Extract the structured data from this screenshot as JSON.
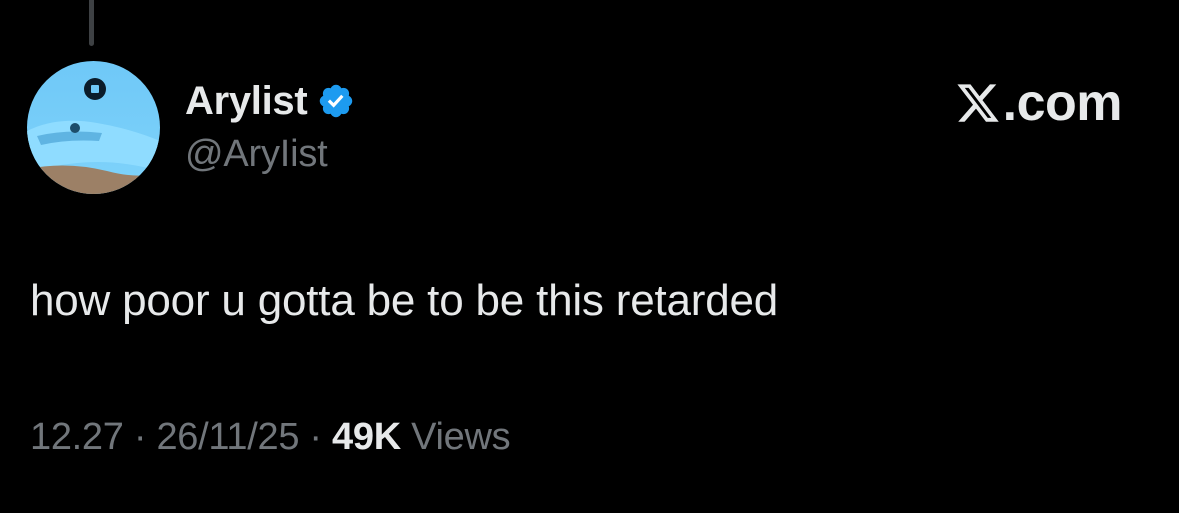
{
  "post": {
    "author": {
      "display_name": "Arylist",
      "handle": "@AryIist",
      "verified": true,
      "verified_icon": "verified-badge-icon",
      "verified_color": "#1d9bf0"
    },
    "brand": {
      "icon": "x-logo-icon",
      "text": ".com"
    },
    "text": "how poor u gotta be to be this retarded",
    "meta": {
      "time": "12.27",
      "separator": " · ",
      "date": "26/11/25",
      "views_count": "49K",
      "views_label": "Views"
    }
  },
  "colors": {
    "background": "#000000",
    "primary_text": "#e7e9ea",
    "secondary_text": "#71767b",
    "accent": "#1d9bf0"
  }
}
